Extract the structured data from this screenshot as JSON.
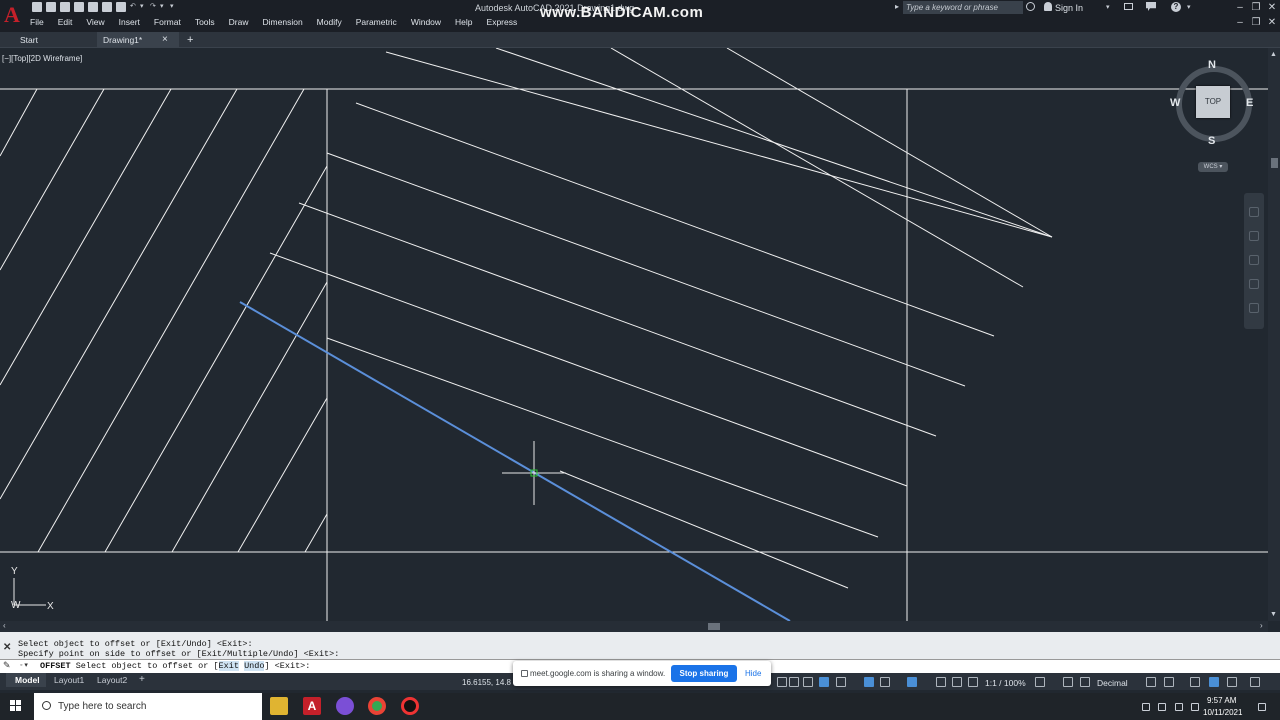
{
  "app": {
    "window_title": "Autodesk AutoCAD 2021   Drawing1.dwg",
    "watermark": "www.BANDICAM.com",
    "search_placeholder": "Type a keyword or phrase",
    "sign_in": "Sign In",
    "logo": "A"
  },
  "menu": [
    "File",
    "Edit",
    "View",
    "Insert",
    "Format",
    "Tools",
    "Draw",
    "Dimension",
    "Modify",
    "Parametric",
    "Window",
    "Help",
    "Express"
  ],
  "tabs": {
    "start": "Start",
    "drawing": "Drawing1*",
    "close": "×",
    "add": "+"
  },
  "viewport": {
    "label": "[−][Top][2D Wireframe]",
    "viewcube": {
      "face": "TOP",
      "north": "N",
      "south": "S",
      "east": "E",
      "west": "W",
      "wcs": "WCS ▾"
    },
    "ucs": {
      "x": "X",
      "y": "Y",
      "w": "W"
    }
  },
  "command": {
    "history": [
      "Select object to offset or [Exit/Undo] <Exit>:",
      "Specify point on side to offset or [Exit/Multiple/Undo] <Exit>:"
    ],
    "keyword": "OFFSET",
    "prompt_before": " Select object to offset or [",
    "opt_exit": "Exit",
    "opt_undo": "Undo",
    "prompt_after": "] <Exit>:"
  },
  "status": {
    "layouts": [
      "Model",
      "Layout1",
      "Layout2"
    ],
    "coordinates": "16.6155, 14.8",
    "scale": "1:1 / 100%",
    "units": "Decimal"
  },
  "share": {
    "text": "meet.google.com is sharing a window.",
    "stop": "Stop sharing",
    "hide": "Hide"
  },
  "taskbar": {
    "search_placeholder": "Type here to search",
    "time": "9:57 AM",
    "date": "10/11/2021"
  },
  "colors": {
    "canvas": "#212830",
    "selected_line": "#5b8fd9",
    "cad_line": "#f0f0f0",
    "cursor_marker": "#29c431"
  }
}
